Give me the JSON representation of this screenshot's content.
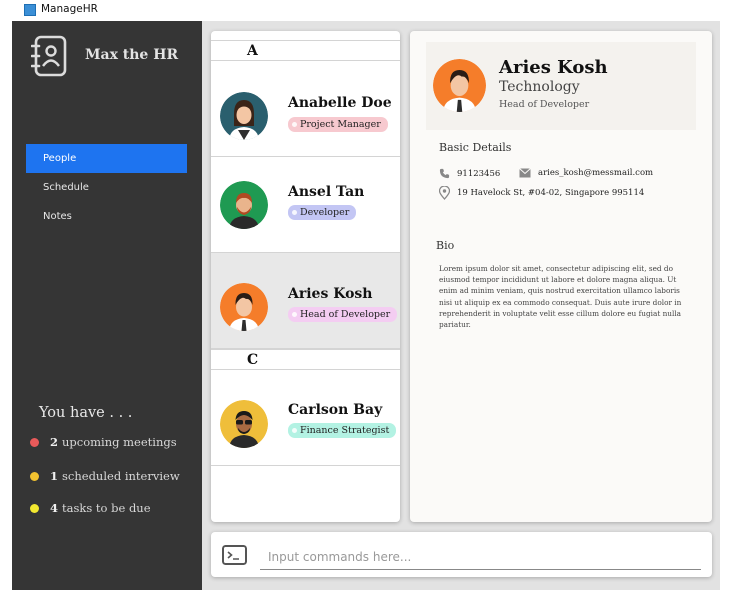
{
  "window": {
    "title": "ManageHR",
    "icon": "app-window-icon"
  },
  "sidebar": {
    "brand": "Max the HR",
    "logo_icon": "address-book-icon",
    "nav": [
      {
        "label": "People",
        "active": true
      },
      {
        "label": "Schedule",
        "active": false
      },
      {
        "label": "Notes",
        "active": false
      }
    ],
    "summary_title": "You have . . .",
    "reminders": [
      {
        "count": "2",
        "text": "upcoming meetings",
        "color": "#e85a5a"
      },
      {
        "count": "1",
        "text": "scheduled interview",
        "color": "#f2c230"
      },
      {
        "count": "4",
        "text": "tasks to be due",
        "color": "#f2e830"
      }
    ]
  },
  "contacts": {
    "sections": [
      "A",
      "C"
    ],
    "people": [
      {
        "name": "Anabelle Doe",
        "tag": "Project Manager",
        "tag_color": "#f7c9cf"
      },
      {
        "name": "Ansel Tan",
        "tag": "Developer",
        "tag_color": "#c3c6f4"
      },
      {
        "name": "Aries Kosh",
        "tag": "Head of Developer",
        "tag_color": "#f4cdf2",
        "selected": true
      },
      {
        "name": "Carlson Bay",
        "tag": "Finance Strategist",
        "tag_color": "#b3f2e3"
      }
    ]
  },
  "detail": {
    "name": "Aries Kosh",
    "department": "Technology",
    "role": "Head of Developer",
    "basic_details_title": "Basic Details",
    "phone": "91123456",
    "email": "aries_kosh@messmail.com",
    "address": "19 Havelock St, #04-02, Singapore 995114",
    "bio_title": "Bio",
    "bio": "Lorem ipsum dolor sit amet, consectetur adipiscing elit, sed do eiusmod tempor incididunt ut labore et dolore magna aliqua. Ut enim ad minim veniam, quis nostrud exercitation ullamco laboris nisi ut aliquip ex ea commodo consequat. Duis aute irure dolor in reprehenderit in voluptate velit esse cillum dolore eu fugiat nulla pariatur."
  },
  "command": {
    "placeholder": "Input commands here...",
    "icon": "terminal-icon"
  }
}
